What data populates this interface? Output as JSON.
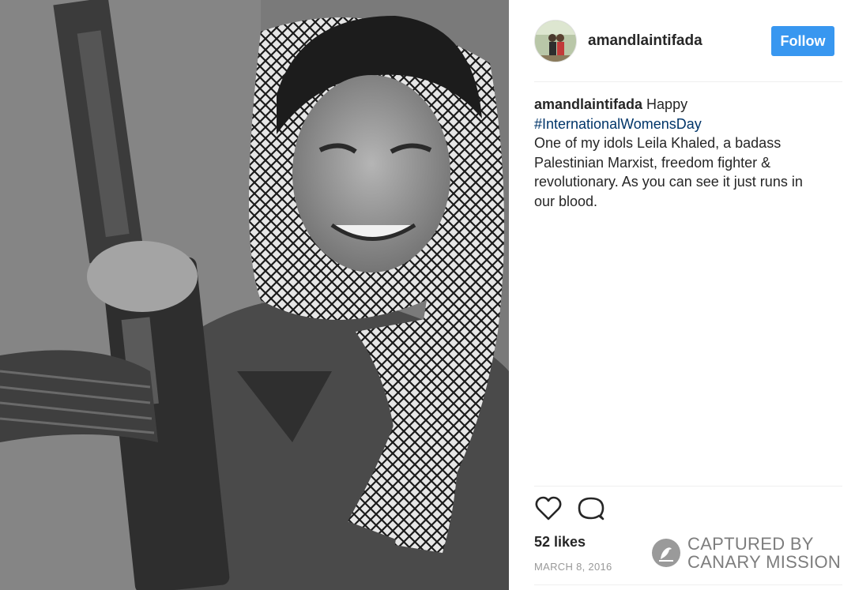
{
  "post": {
    "username": "amandlaintifada",
    "follow_label": "Follow",
    "caption": {
      "username": "amandlaintifada",
      "lead": "Happy",
      "hashtag": "#InternationalWomensDay",
      "body": "One of my idols Leila Khaled, a badass Palestinian Marxist, freedom fighter & revolutionary. As you can see it just runs in our blood."
    },
    "likes": "52 likes",
    "date": "MARCH 8, 2016"
  },
  "watermark": {
    "line1": "CAPTURED BY",
    "line2": "CANARY MISSION"
  },
  "icons": {
    "like": "heart-icon",
    "comment": "comment-bubble-icon",
    "watermark_logo": "canary-bird-icon"
  },
  "colors": {
    "follow_button": "#3897f0",
    "hashtag": "#003569",
    "text": "#262626",
    "muted": "#999999",
    "watermark": "#7d7d7d"
  }
}
